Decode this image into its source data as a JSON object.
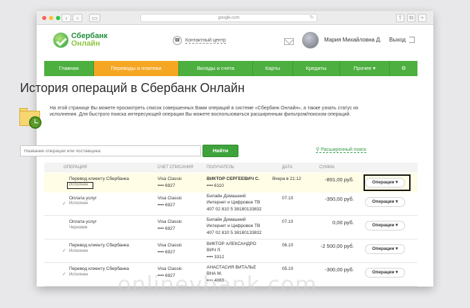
{
  "browser": {
    "address": "google.com",
    "dot_colors": [
      "#fe5f57",
      "#febc2e",
      "#28c840"
    ]
  },
  "header": {
    "logo_line1": "Сбербанк",
    "logo_line2": "Онлайн",
    "contact_label": "Контактный центр",
    "user_name": "Мария Михайловна Д.",
    "logout_label": "Выход"
  },
  "menu": [
    {
      "label": "Главная"
    },
    {
      "label": "Переводы и платежи",
      "active": true
    },
    {
      "label": "Вклады и счета"
    },
    {
      "label": "Карты"
    },
    {
      "label": "Кредиты"
    },
    {
      "label": "Прочее ▾"
    },
    {
      "label": "⚙"
    }
  ],
  "page": {
    "title": "История операций в Сбербанк Онлайн",
    "intro": "На этой странице Вы можете просмотреть список совершенных Вами операций в системе «Сбербанк Онлайн», а также узнать статус их исполнения. Для быстрого поиска интересующей операции Вы можете воспользоваться расширенным фильтром/поиском операций.",
    "search_placeholder": "Название операции или поставщика",
    "find_label": "Найти",
    "advanced_search": "Расширенный поиск"
  },
  "table": {
    "headers": [
      "Операция",
      "Счет списания",
      "Получатель",
      "Дата",
      "Сумма"
    ],
    "rows": [
      {
        "operation": "Перевод клиенту Сбербанка",
        "status": "Исполнен",
        "account": "Visa Classic",
        "account_num": "•••• 6927",
        "recipient": "ВИКТОР СЕРГЕЕВИЧ С.",
        "recipient2": "",
        "recipient_num": "•••• 6110",
        "date": "Вчера в 21:12",
        "amount": "-891,00 руб.",
        "ops": "Операции ▾",
        "highlight": true
      },
      {
        "operation": "Оплата услуг",
        "status": "Исполнен",
        "account": "Visa Classic",
        "account_num": "•••• 6927",
        "recipient": "Билайн Домашний",
        "recipient2": "Интернет и Цифровое ТВ",
        "recipient_num": "407 02 810 5 38180133832",
        "date": "07.10",
        "amount": "-350,00 руб.",
        "ops": "Операции ▾",
        "highlight": false
      },
      {
        "operation": "Оплата услуг",
        "status": "Черновик",
        "account": "Visa Classic",
        "account_num": "•••• 6927",
        "recipient": "Билайн Домашний",
        "recipient2": "Интернет и Цифровое ТВ",
        "recipient_num": "407 02 810 5 38180133832",
        "date": "07.10",
        "amount": "0,00 руб.",
        "ops": "Операции ▾",
        "highlight": false
      },
      {
        "operation": "Перевод клиенту Сбербанка",
        "status": "Исполнен",
        "account": "Visa Classic",
        "account_num": "•••• 6927",
        "recipient": "ВИКТОР АЛЕКСАНДРО",
        "recipient2": "ВИЧ Л.",
        "recipient_num": "•••• 3312",
        "date": "06.10",
        "amount": "-2 500,00 руб.",
        "ops": "Операции ▾",
        "highlight": false
      },
      {
        "operation": "Перевод клиенту Сбербанка",
        "status": "Исполнен",
        "account": "Visa Classic",
        "account_num": "•••• 6927",
        "recipient": "АНАСТАСИЯ ВИТАЛЬЕ",
        "recipient2": "ВНА М.",
        "recipient_num": "•••• 4069",
        "date": "05.10",
        "amount": "-300,00 руб.",
        "ops": "Операции ▾",
        "highlight": false
      }
    ]
  },
  "watermark": "onlinevbank.com"
}
